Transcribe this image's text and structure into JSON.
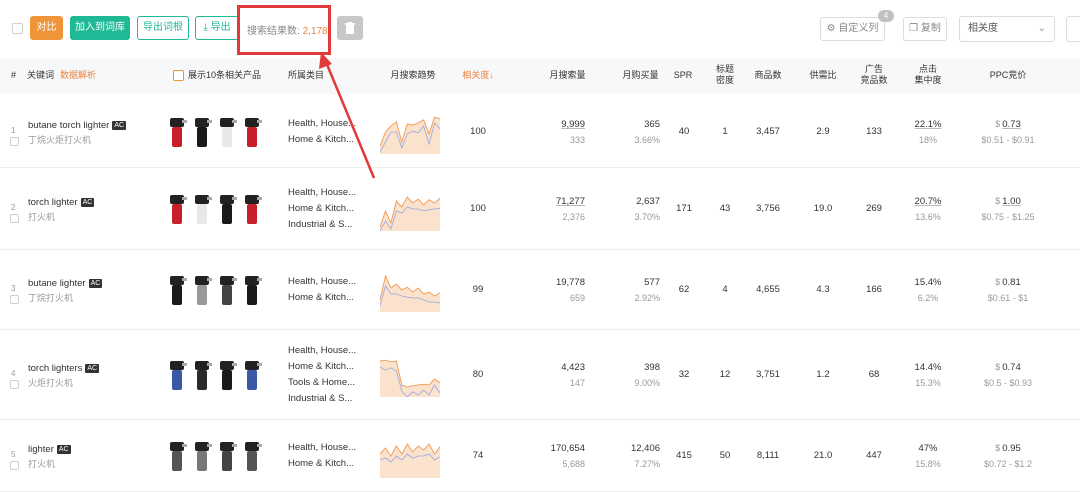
{
  "toolbar": {
    "compare_label": "对比",
    "add_to_root_label": "加入到词库",
    "export_link_label": "导出词根",
    "export_label": "导出",
    "result_count_label": "搜索结果数:",
    "result_count_value": "2,178",
    "custom_columns_label": "自定义列",
    "custom_columns_badge": "4",
    "copy_label": "复制",
    "sort_select_value": "相关度"
  },
  "table": {
    "headers": {
      "index": "#",
      "keyword": "关键词",
      "keyword_link": "数据解析",
      "show_top10": "展示10条相关产品",
      "category": "所属类目",
      "trend": "月搜索趋势",
      "relevance": "相关度↓",
      "monthly_search": "月搜索量",
      "monthly_purchase": "月购买量",
      "spr": "SPR",
      "title_density_1": "标题",
      "title_density_2": "密度",
      "product_count": "商品数",
      "supply_ratio": "供需比",
      "ad_products_1": "广告",
      "ad_products_2": "竞品数",
      "click_conc_1": "点击",
      "click_conc_2": "集中度",
      "ppc": "PPC竞价"
    },
    "rows": [
      {
        "index": "1",
        "keyword": "butane torch lighter",
        "ac": "AC",
        "keyword_cn": "丁烷火炬打火机",
        "categories": [
          "Health, House...",
          "Home & Kitch..."
        ],
        "relevance": "100",
        "monthly_search": "9,999",
        "monthly_search_sub": "333",
        "monthly_purchase": "365",
        "monthly_purchase_sub": "3.66%",
        "spr": "40",
        "title_density": "1",
        "product_count": "3,457",
        "supply_ratio": "2.9",
        "ad_products": "133",
        "click_conc": "22.1%",
        "click_conc_sub": "18%",
        "ppc": "0.73",
        "ppc_range": "$0.51 - $0.91",
        "trend": [
          0.2,
          0.55,
          0.7,
          0.8,
          0.3,
          0.75,
          0.72,
          0.78,
          0.85,
          0.5,
          0.92,
          0.88
        ]
      },
      {
        "index": "2",
        "keyword": "torch lighter",
        "ac": "AC",
        "keyword_cn": "打火机",
        "categories": [
          "Health, House...",
          "Home & Kitch...",
          "Industrial & S..."
        ],
        "relevance": "100",
        "monthly_search": "71,277",
        "monthly_search_sub": "2,376",
        "monthly_purchase": "2,637",
        "monthly_purchase_sub": "3.70%",
        "spr": "171",
        "title_density": "43",
        "product_count": "3,756",
        "supply_ratio": "19.0",
        "ad_products": "269",
        "click_conc": "20.7%",
        "click_conc_sub": "13.6%",
        "ppc": "1.00",
        "ppc_range": "$0.75 - $1.25",
        "trend": [
          0.1,
          0.5,
          0.2,
          0.75,
          0.6,
          0.85,
          0.7,
          0.8,
          0.65,
          0.78,
          0.7,
          0.82
        ]
      },
      {
        "index": "3",
        "keyword": "butane lighter",
        "ac": "AC",
        "keyword_cn": "丁烷打火机",
        "categories": [
          "Health, House...",
          "Home & Kitch..."
        ],
        "relevance": "99",
        "monthly_search": "19,778",
        "monthly_search_sub": "659",
        "monthly_purchase": "577",
        "monthly_purchase_sub": "2.92%",
        "spr": "62",
        "title_density": "4",
        "product_count": "4,655",
        "supply_ratio": "4.3",
        "ad_products": "166",
        "click_conc": "15.4%",
        "click_conc_sub": "6.2%",
        "ppc": "0.81",
        "ppc_range": "$0.61 - $1",
        "trend": [
          0.3,
          0.9,
          0.6,
          0.7,
          0.55,
          0.62,
          0.5,
          0.6,
          0.45,
          0.5,
          0.4,
          0.48
        ]
      },
      {
        "index": "4",
        "keyword": "torch lighters",
        "ac": "AC",
        "keyword_cn": "火炬打火机",
        "categories": [
          "Health, House...",
          "Home & Kitch...",
          "Tools & Home...",
          "Industrial & S..."
        ],
        "relevance": "80",
        "monthly_search": "4,423",
        "monthly_search_sub": "147",
        "monthly_purchase": "398",
        "monthly_purchase_sub": "9.00%",
        "spr": "32",
        "title_density": "12",
        "product_count": "3,751",
        "supply_ratio": "1.2",
        "ad_products": "68",
        "click_conc": "14.4%",
        "click_conc_sub": "15.3%",
        "ppc": "0.74",
        "ppc_range": "$0.5 - $0.93",
        "trend": [
          0.9,
          0.92,
          0.88,
          0.9,
          0.3,
          0.25,
          0.28,
          0.3,
          0.32,
          0.3,
          0.45,
          0.35
        ]
      },
      {
        "index": "5",
        "keyword": "lighter",
        "ac": "AC",
        "keyword_cn": "打火机",
        "categories": [
          "Health, House...",
          "Home & Kitch..."
        ],
        "relevance": "74",
        "monthly_search": "170,654",
        "monthly_search_sub": "5,688",
        "monthly_purchase": "12,406",
        "monthly_purchase_sub": "7.27%",
        "spr": "415",
        "title_density": "50",
        "product_count": "8,111",
        "supply_ratio": "21.0",
        "ad_products": "447",
        "click_conc": "47%",
        "click_conc_sub": "15.8%",
        "ppc": "0.95",
        "ppc_range": "$0.72 - $1.2",
        "trend": [
          0.6,
          0.75,
          0.55,
          0.8,
          0.6,
          0.85,
          0.65,
          0.8,
          0.7,
          0.85,
          0.6,
          0.78
        ]
      }
    ]
  },
  "colors": {
    "accent_orange": "#f0823a",
    "accent_green": "#1fb996",
    "highlight_red": "#e03a3a",
    "trend_fill": "#fbe2cc",
    "trend_line": "#f0a060",
    "trend_line2": "#9aa6e0"
  }
}
